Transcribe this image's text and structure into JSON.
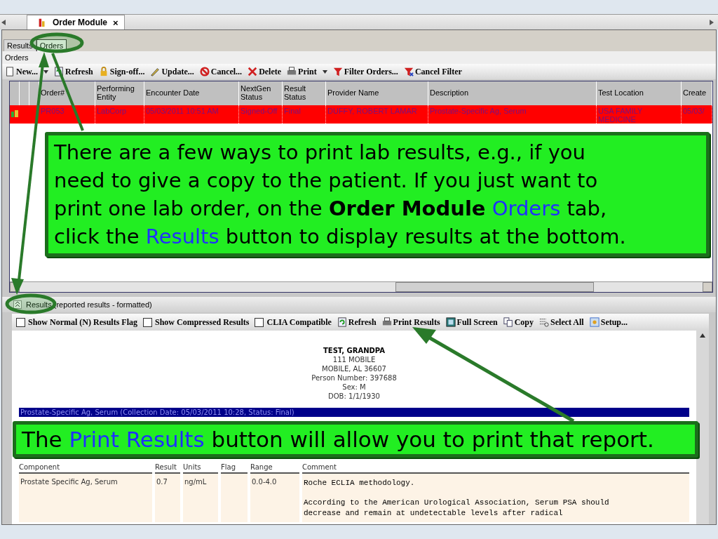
{
  "document_tab": {
    "title": "Order Module",
    "close": "×"
  },
  "inner_tabs": [
    {
      "label": "Results",
      "selected": false
    },
    {
      "label": "Orders",
      "selected": true
    }
  ],
  "orders_group": {
    "title": "Orders"
  },
  "orders_toolbar": [
    {
      "label": "New...",
      "dropdown": true
    },
    {
      "label": "Refresh",
      "dropdown": false
    },
    {
      "label": "Sign-off...",
      "dropdown": false
    },
    {
      "label": "Update...",
      "dropdown": false
    },
    {
      "label": "Cancel...",
      "dropdown": false
    },
    {
      "label": "Delete",
      "dropdown": false
    },
    {
      "label": "Print",
      "dropdown": true
    },
    {
      "label": "Filter Orders...",
      "dropdown": false
    },
    {
      "label": "Cancel Filter",
      "dropdown": false
    }
  ],
  "orders_table": {
    "columns": [
      "Order#",
      "Performing Entity",
      "Encounter Date",
      "NextGen Status",
      "Result Status",
      "Provider Name",
      "Description",
      "Test Location",
      "Create"
    ],
    "rows": [
      {
        "selected": true,
        "cells": [
          "PR053",
          "LabCorp",
          "05/03/2011 10:51 AM",
          "Signed-Off",
          "Final",
          "DUFFY, ROBERT LAMAR",
          "Prostate-Specific Ag, Serum",
          "USA FAMILY MEDICINE",
          "05/03/"
        ]
      }
    ]
  },
  "results_panel": {
    "title": "Results (reported results - formatted)"
  },
  "results_toolbar": [
    {
      "kind": "checkbox",
      "label": "Show Normal (N) Results Flag",
      "checked": false
    },
    {
      "kind": "checkbox",
      "label": "Show Compressed Results",
      "checked": false
    },
    {
      "kind": "checkbox",
      "label": "CLIA Compatible",
      "checked": false
    },
    {
      "kind": "button",
      "label": "Refresh"
    },
    {
      "kind": "button",
      "label": "Print Results"
    },
    {
      "kind": "button",
      "label": "Full Screen"
    },
    {
      "kind": "button",
      "label": "Copy"
    },
    {
      "kind": "button",
      "label": "Select All"
    },
    {
      "kind": "button",
      "label": "Setup..."
    }
  ],
  "report": {
    "patient_name": "TEST, GRANDPA",
    "details": [
      "111 MOBILE",
      "MOBILE, AL 36607",
      "Person Number: 397688",
      "Sex: M",
      "DOB: 1/1/1930"
    ],
    "section_title": "Prostate-Specific Ag, Serum (Collection Date: 05/03/2011 10:28, Status: Final)",
    "columns": [
      "Component",
      "Result",
      "Units",
      "Flag",
      "Range",
      "Comment"
    ],
    "rows": [
      {
        "component": "Prostate Specific Ag, Serum",
        "result": "0.7",
        "units": "ng/mL",
        "range": "0.0-4.0",
        "comment": [
          "Roche ECLIA methodology.",
          "According to the American Urological Association, Serum PSA should",
          "decrease and remain at undetectable levels after radical"
        ]
      }
    ]
  },
  "callouts": [
    {
      "lines": [
        [
          {
            "kind": "plain",
            "text": "There are a few ways to print lab results, e.g., if you"
          }
        ],
        [
          {
            "kind": "plain",
            "text": "need to give a copy to the patient.  If you just want to"
          }
        ],
        [
          {
            "kind": "plain",
            "text": "print one lab order, on the "
          },
          {
            "kind": "bold",
            "text": "Order Module"
          },
          {
            "kind": "blue",
            "text": " Orders"
          },
          {
            "kind": "plain",
            "text": " tab,"
          }
        ],
        [
          {
            "kind": "plain",
            "text": "click the "
          },
          {
            "kind": "blue",
            "text": "Results"
          },
          {
            "kind": "plain",
            "text": " button to display results at the bottom."
          }
        ]
      ]
    },
    {
      "lines": [
        [
          {
            "kind": "plain",
            "text": "The "
          },
          {
            "kind": "blue",
            "text": "Print Results"
          },
          {
            "kind": "plain",
            "text": " button will allow you to print that report."
          }
        ]
      ]
    }
  ]
}
